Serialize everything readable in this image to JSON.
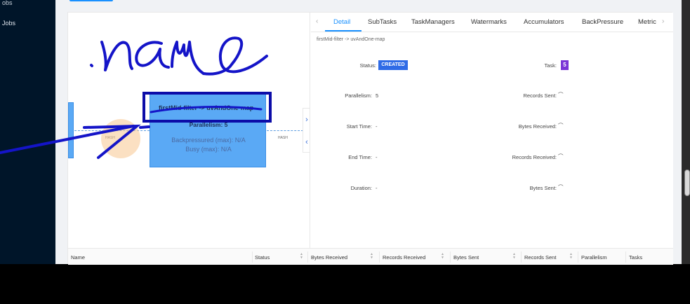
{
  "sidebar": {
    "items": [
      {
        "label": "obs"
      },
      {
        "label": "Jobs"
      }
    ]
  },
  "graph": {
    "operator": {
      "title": "firstMid-filter -> uvAndOne-map",
      "parallelism": "Parallelism: 5",
      "backpressured": "Backpressured (max): N/A",
      "busy": "Busy (max): N/A"
    },
    "edge_in_label": "HASH",
    "edge_out_label": "HASH"
  },
  "detail": {
    "tabs": [
      "Detail",
      "SubTasks",
      "TaskManagers",
      "Watermarks",
      "Accumulators",
      "BackPressure",
      "Metric"
    ],
    "active_tab": "Detail",
    "subtitle": "firstMid-filter -> uvAndOne-map",
    "fields": {
      "status_label": "Status:",
      "status_value": "CREATED",
      "task_label": "Task:",
      "task_value": "5",
      "parallelism_label": "Parallelism:",
      "parallelism_value": "5",
      "records_sent_label": "Records Sent:",
      "records_sent_value": "⌒",
      "start_time_label": "Start Time:",
      "start_time_value": "-",
      "bytes_received_label": "Bytes Received:",
      "bytes_received_value": "⌒",
      "end_time_label": "End Time:",
      "end_time_value": "-",
      "records_received_label": "Records Received:",
      "records_received_value": "⌒",
      "duration_label": "Duration:",
      "duration_value": "-",
      "bytes_sent_label": "Bytes Sent:",
      "bytes_sent_value": "⌒"
    }
  },
  "table": {
    "columns": [
      "Name",
      "Status",
      "Bytes Received",
      "Records Received",
      "Bytes Sent",
      "Records Sent",
      "Parallelism",
      "Tasks"
    ]
  },
  "annotation": {
    "handwritten_text": ".name"
  },
  "colors": {
    "sidebar_bg": "#001529",
    "accent": "#1890ff",
    "node_fill": "#5aa9f5",
    "status_created": "#2f6be6",
    "task_tag": "#7b35d6",
    "ink": "#1414c8"
  }
}
